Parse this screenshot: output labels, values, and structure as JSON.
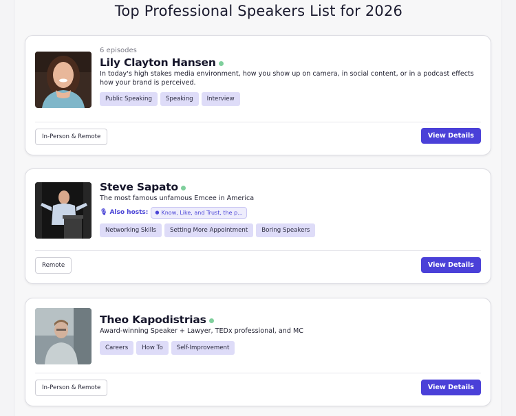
{
  "page": {
    "title": "Top Professional Speakers List for 2026"
  },
  "colors": {
    "accent": "#4a40d8",
    "tag_bg": "#dedcf8",
    "online": "#7fcf9c"
  },
  "speakers": [
    {
      "episodes": "6 episodes",
      "name": "Lily Clayton Hansen",
      "tagline": "In today's high stakes media environment, how you show up on camera, in social content, or in a podcast effects how your brand is perceived.",
      "tags": [
        "Public Speaking",
        "Speaking",
        "Interview"
      ],
      "format": "In-Person & Remote",
      "action": "View Details"
    },
    {
      "name": "Steve Sapato",
      "tagline": "The most famous unfamous Emcee in America",
      "hosts_label": "Also hosts:",
      "hosts_value": "Know, Like, and Trust, the p...",
      "tags": [
        "Networking Skills",
        "Setting More Appointment",
        "Boring Speakers"
      ],
      "format": "Remote",
      "action": "View Details"
    },
    {
      "name": "Theo Kapodistrias",
      "tagline": "Award-winning Speaker + Lawyer, TEDx professional, and MC",
      "tags": [
        "Careers",
        "How To",
        "Self-Improvement"
      ],
      "format": "In-Person & Remote",
      "action": "View Details"
    }
  ]
}
